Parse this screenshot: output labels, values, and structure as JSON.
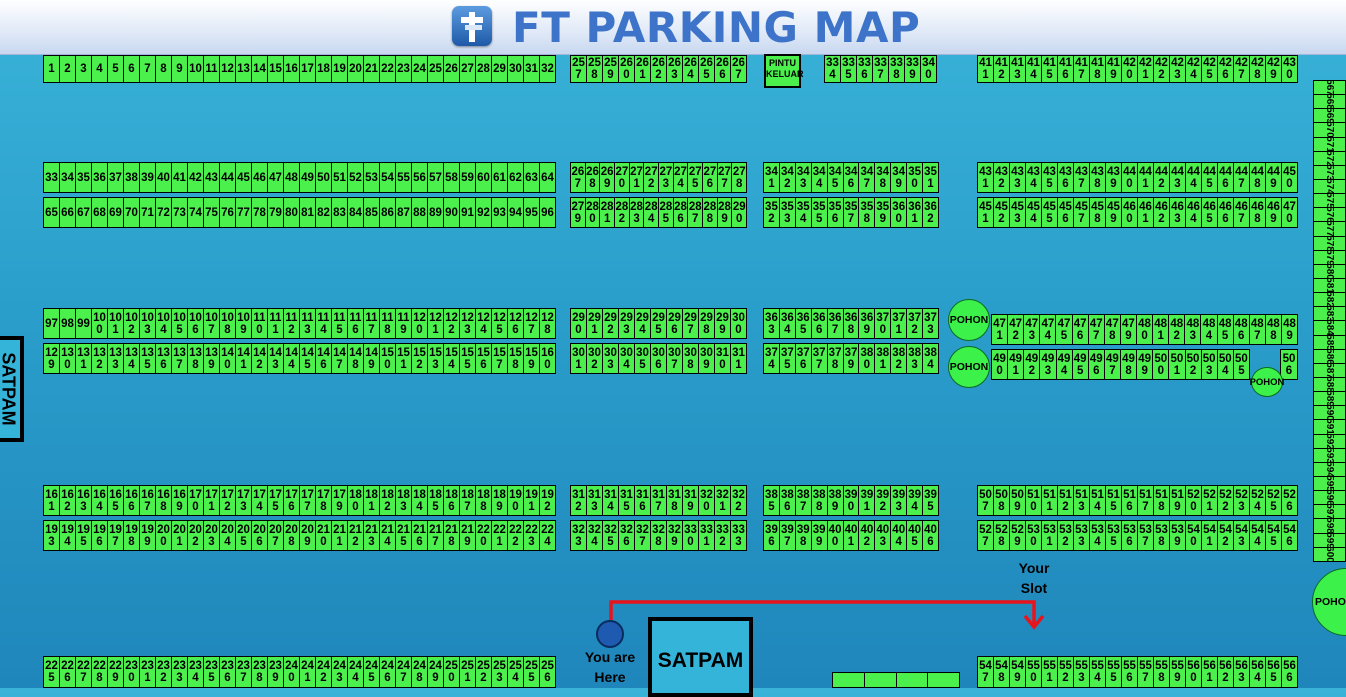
{
  "header": {
    "title": "FT PARKING MAP",
    "logo_icon": "cross-road-sign-icon"
  },
  "colors": {
    "slot_fill": "#4cf04c",
    "route": "#e8141b",
    "marker": "#1e5bb0",
    "tree": "#3cf24a"
  },
  "landmarks": {
    "pintu_keluar": "PINTU\nKELUAR",
    "satpam_bottom": "SATPAM",
    "satpam_side": "SATPAM",
    "you_are_here": "You are\nHere",
    "your_slot": "Your\nSlot",
    "trees": [
      "POHON",
      "POHON",
      "POHON",
      "POHON"
    ]
  },
  "rows": {
    "r1a": {
      "start": 1,
      "count": 32
    },
    "r1b": {
      "start": 257,
      "count": 11
    },
    "r1c": {
      "start": 334,
      "count": 7
    },
    "r1d": {
      "start": 411,
      "count": 20
    },
    "r2a": {
      "start": 33,
      "count": 32
    },
    "r2b": {
      "start": 267,
      "count": 12
    },
    "r2c": {
      "start": 341,
      "count": 11
    },
    "r2d": {
      "start": 431,
      "count": 20
    },
    "r3a": {
      "start": 65,
      "count": 32
    },
    "r3b": {
      "start": 279,
      "count": 12
    },
    "r3c": {
      "start": 352,
      "count": 11
    },
    "r3d": {
      "start": 451,
      "count": 20
    },
    "r4a": {
      "start": 97,
      "count": 32
    },
    "r4b": {
      "start": 290,
      "count": 11
    },
    "r4c": {
      "start": 363,
      "count": 11
    },
    "r4d": {
      "start": 471,
      "count": 19
    },
    "r5a": {
      "start": 129,
      "count": 32
    },
    "r5b": {
      "start": 301,
      "count": 11
    },
    "r5c": {
      "start": 374,
      "count": 11
    },
    "r5d": {
      "start": 490,
      "count": 16
    },
    "r5e": {
      "start": 506,
      "count": 1
    },
    "r6a": {
      "start": 161,
      "count": 32
    },
    "r6b": {
      "start": 312,
      "count": 11
    },
    "r6c": {
      "start": 385,
      "count": 11
    },
    "r6d": {
      "start": 507,
      "count": 20
    },
    "r7a": {
      "start": 193,
      "count": 32
    },
    "r7b": {
      "start": 323,
      "count": 11
    },
    "r7c": {
      "start": 396,
      "count": 11
    },
    "r7d": {
      "start": 527,
      "count": 20
    },
    "r8a": {
      "start": 225,
      "count": 32
    },
    "r8b": {
      "start": 547,
      "count": 20
    },
    "vcol": {
      "start": 567,
      "count": 34
    }
  }
}
